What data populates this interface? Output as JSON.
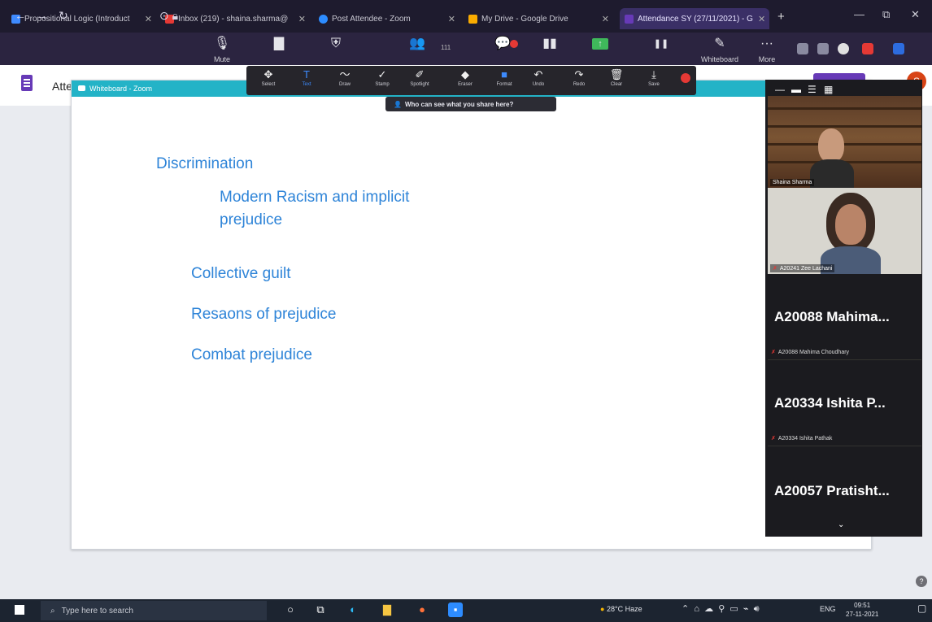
{
  "browser": {
    "tabs": [
      {
        "title": "Propositional Logic (Introduct",
        "color": "#3f8bff"
      },
      {
        "title": "Inbox (219) - shaina.sharma@",
        "color": "#e53935"
      },
      {
        "title": "Post Attendee - Zoom",
        "color": "#2d8cff"
      },
      {
        "title": "My Drive - Google Drive",
        "color": "#f9ab00"
      },
      {
        "title": "Attendance SY (27/11/2021) - G",
        "color": "#673ab7"
      }
    ],
    "new_tab": "+",
    "window_controls": [
      "—",
      "⧉",
      "✕"
    ]
  },
  "zoom_bar": {
    "items": [
      {
        "icon": "mic-icon",
        "glyph": "🎙",
        "label": "Mute"
      },
      {
        "icon": "video-icon",
        "glyph": "▇",
        "label": ""
      },
      {
        "icon": "security-icon",
        "glyph": "⛨",
        "label": ""
      },
      {
        "icon": "participants-icon",
        "glyph": "👥",
        "label": ""
      },
      {
        "icon": "chat-icon",
        "glyph": "💬",
        "label": ""
      },
      {
        "icon": "polls-icon",
        "glyph": "▮▮",
        "label": ""
      },
      {
        "icon": "share-icon",
        "glyph": "↑",
        "label": ""
      },
      {
        "icon": "pause-icon",
        "glyph": "❚❚",
        "label": ""
      },
      {
        "icon": "whiteboard-icon",
        "glyph": "✎",
        "label": "Whiteboard"
      },
      {
        "icon": "more-icon",
        "glyph": "···",
        "label": "More"
      }
    ],
    "participant_count": "111",
    "chat_badge": "1"
  },
  "page": {
    "title": "Atte",
    "avatar_letter": "S"
  },
  "annotation_toolbar": {
    "tools": [
      {
        "icon": "select-icon",
        "glyph": "✥",
        "label": "Select"
      },
      {
        "icon": "text-icon",
        "glyph": "T",
        "label": "Text",
        "selected": true
      },
      {
        "icon": "draw-icon",
        "glyph": "〜",
        "label": "Draw"
      },
      {
        "icon": "stamp-icon",
        "glyph": "✓",
        "label": "Stamp"
      },
      {
        "icon": "spotlight-icon",
        "glyph": "✐",
        "label": "Spotlight"
      },
      {
        "icon": "eraser-icon",
        "glyph": "◆",
        "label": "Eraser"
      },
      {
        "icon": "format-icon",
        "glyph": "■",
        "label": "Format"
      },
      {
        "icon": "undo-icon",
        "glyph": "↶",
        "label": "Undo"
      },
      {
        "icon": "redo-icon",
        "glyph": "↷",
        "label": "Redo"
      },
      {
        "icon": "clear-icon",
        "glyph": "🗑",
        "label": "Clear"
      },
      {
        "icon": "save-icon",
        "glyph": "⤓",
        "label": "Save"
      }
    ],
    "who_can_see": "Who can see what you share here?"
  },
  "whiteboard": {
    "window_title": "Whiteboard - Zoom",
    "lines": [
      "Discrimination",
      "Modern Racism and implicit prejudice",
      "Collective guilt",
      "Resaons of prejudice",
      "Combat prejudice"
    ]
  },
  "gallery": {
    "videos": [
      {
        "name": "Shaina Sharma"
      },
      {
        "name": "A20241 Zee Lachani"
      }
    ],
    "tiles": [
      {
        "display": "A20088  Mahima...",
        "full_name": "A20088 Mahima Choudhary"
      },
      {
        "display": "A20334  Ishita P...",
        "full_name": "A20334 Ishita Pathak"
      },
      {
        "display": "A20057  Pratisht...",
        "full_name": ""
      }
    ]
  },
  "taskbar": {
    "search_placeholder": "Type here to search",
    "weather": "28°C  Haze",
    "language": "ENG",
    "time": "09:51",
    "date": "27-11-2021"
  }
}
